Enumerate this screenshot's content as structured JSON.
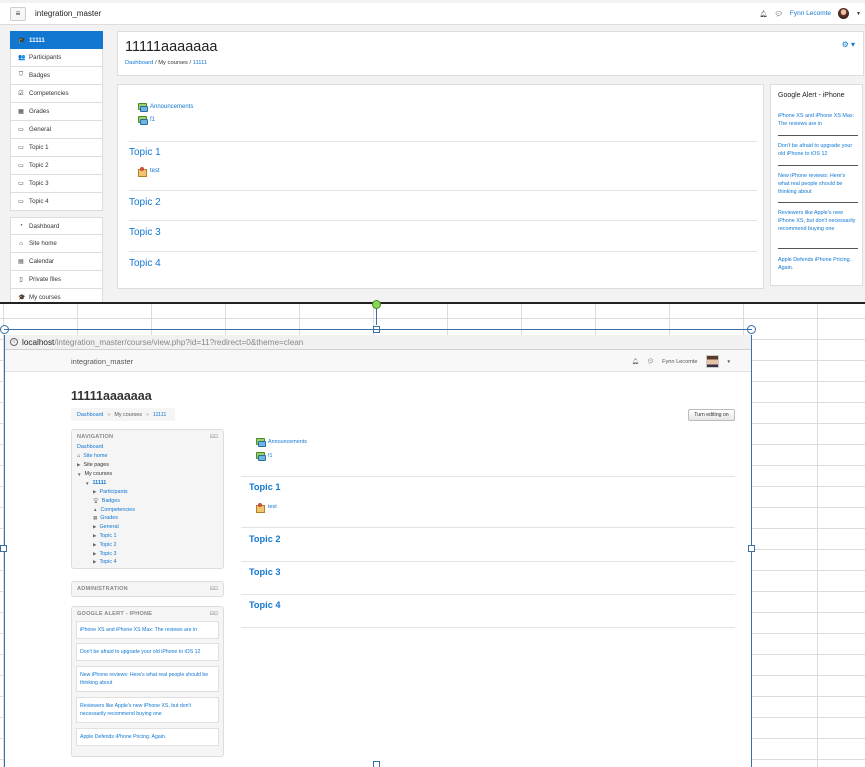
{
  "boost": {
    "site_name": "integration_master",
    "user_name": "Fynn Lecomte",
    "course_title": "11111aaaaaaa",
    "breadcrumb": [
      "Dashboard",
      "My courses",
      "11111"
    ],
    "drawer_items": [
      {
        "label": "11111",
        "icon": "graduation-cap-icon",
        "glyph": "🎓",
        "active": true
      },
      {
        "label": "Participants",
        "icon": "users-icon",
        "glyph": "👥",
        "active": false
      },
      {
        "label": "Badges",
        "icon": "shield-icon",
        "glyph": "⛉",
        "active": false
      },
      {
        "label": "Competencies",
        "icon": "check-square-icon",
        "glyph": "☑",
        "active": false
      },
      {
        "label": "Grades",
        "icon": "table-icon",
        "glyph": "▦",
        "active": false
      },
      {
        "label": "General",
        "icon": "folder-icon",
        "glyph": "▭",
        "active": false
      },
      {
        "label": "Topic 1",
        "icon": "folder-icon",
        "glyph": "▭",
        "active": false
      },
      {
        "label": "Topic 2",
        "icon": "folder-icon",
        "glyph": "▭",
        "active": false
      },
      {
        "label": "Topic 3",
        "icon": "folder-icon",
        "glyph": "▭",
        "active": false
      },
      {
        "label": "Topic 4",
        "icon": "folder-icon",
        "glyph": "▭",
        "active": false
      }
    ],
    "drawer_items_2": [
      {
        "label": "Dashboard",
        "icon": "dashboard-icon",
        "glyph": "◔"
      },
      {
        "label": "Site home",
        "icon": "home-icon",
        "glyph": "⌂"
      },
      {
        "label": "Calendar",
        "icon": "calendar-icon",
        "glyph": "▤"
      },
      {
        "label": "Private files",
        "icon": "file-icon",
        "glyph": "▯"
      },
      {
        "label": "My courses",
        "icon": "graduation-cap-icon",
        "glyph": "🎓"
      }
    ],
    "activities_general": [
      "Announcements",
      "f1"
    ],
    "topics": [
      "Topic 1",
      "Topic 2",
      "Topic 3",
      "Topic 4"
    ],
    "topic1_activity": "test",
    "block_title": "Google Alert - iPhone",
    "news": [
      "iPhone XS and iPhone XS Max: The reviews are in",
      "Don't be afraid to upgrade your old iPhone to iOS 12",
      "New iPhone reviews: Here's what real people should be thinking about",
      "Reviewers like Apple's new iPhone XS, but don't necessarily recommend buying one",
      "Apple Defends iPhone Pricing. Again."
    ]
  },
  "clean": {
    "url_host": "localhost",
    "url_path": "/integration_master/course/view.php?id=11?redirect=0&theme=clean",
    "site_name": "integration_master",
    "user_name": "Fynn Lecomte",
    "course_title": "11111aaaaaaa",
    "breadcrumb": [
      "Dashboard",
      "My courses",
      "11111"
    ],
    "turn_editing": "Turn editing on",
    "nav_head": "NAVIGATION",
    "nav_dashboard": "Dashboard",
    "nav_site_home": "Site home",
    "nav_site_pages": "Site pages",
    "nav_my_courses": "My courses",
    "nav_course": "11111",
    "nav_course_items": [
      "Participants",
      "Badges",
      "Competencies",
      "Grades",
      "General",
      "Topic 1",
      "Topic 2",
      "Topic 3",
      "Topic 4"
    ],
    "admin_head": "ADMINISTRATION",
    "google_head": "GOOGLE ALERT - IPHONE",
    "news": [
      "iPhone XS and iPhone XS Max: The reviews are in",
      "Don't be afraid to upgrade your old iPhone to iOS 12",
      "New iPhone reviews: Here's what real people should be thinking about",
      "Reviewers like Apple's new iPhone XS, but don't necessarily recommend buying one",
      "Apple Defends iPhone Pricing. Again."
    ],
    "activities_general": [
      "Announcements",
      "f1"
    ],
    "topics": [
      "Topic 1",
      "Topic 2",
      "Topic 3",
      "Topic 4"
    ],
    "topic1_activity": "test"
  },
  "colors": {
    "link": "#1177d1",
    "active": "#1177d1"
  }
}
